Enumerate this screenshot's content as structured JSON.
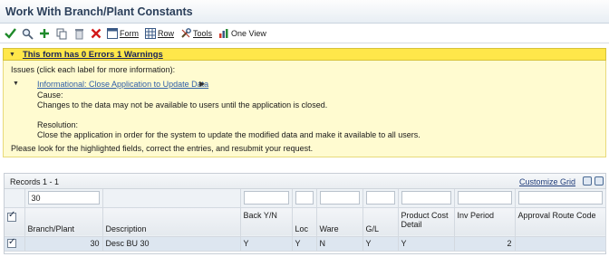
{
  "window": {
    "title": "Work With Branch/Plant Constants"
  },
  "toolbar": {
    "form_label": "Form",
    "form_accel": "F",
    "row_label": "Row",
    "row_accel": "R",
    "tools_label": "Tools",
    "tools_accel": "T",
    "oneview_label": "One View",
    "oneview_accel": "w"
  },
  "colors": {
    "warning_header": "#ffe74a",
    "warning_body": "#fffbd0",
    "link": "#2d5ea8",
    "selected_row": "#dde6f0"
  },
  "warning": {
    "header": "This form has 0 Errors 1 Warnings",
    "issues_intro": "Issues (click each label for more information):",
    "issue_label": "Informational: Close Application to Update Data",
    "cause_title": "Cause:",
    "cause_text": "Changes to the data may not be available to users until the application is closed.",
    "resolution_title": "Resolution:",
    "resolution_text": "Close the application in order for the system to update the modified data and make it available to all users.",
    "footer": "Please look for the highlighted fields, correct the entries, and resubmit your request."
  },
  "grid": {
    "records": "Records 1 - 1",
    "customize": "Customize Grid",
    "qbe": {
      "branch_plant": "30"
    },
    "headers": {
      "branch_plant": "Branch/Plant",
      "description": "Description",
      "back": "Back Y/N",
      "loc": "Loc",
      "ware": "Ware",
      "gl": "G/L",
      "product_cost": "Product Cost Detail",
      "inv_period": "Inv Period",
      "approval": "Approval Route Code"
    },
    "rows": [
      {
        "branch_plant": "30",
        "description": "Desc BU 30",
        "back": "Y",
        "loc": "Y",
        "ware": "N",
        "gl": "Y",
        "product_cost": "Y",
        "inv_period": "2",
        "approval": ""
      }
    ]
  }
}
